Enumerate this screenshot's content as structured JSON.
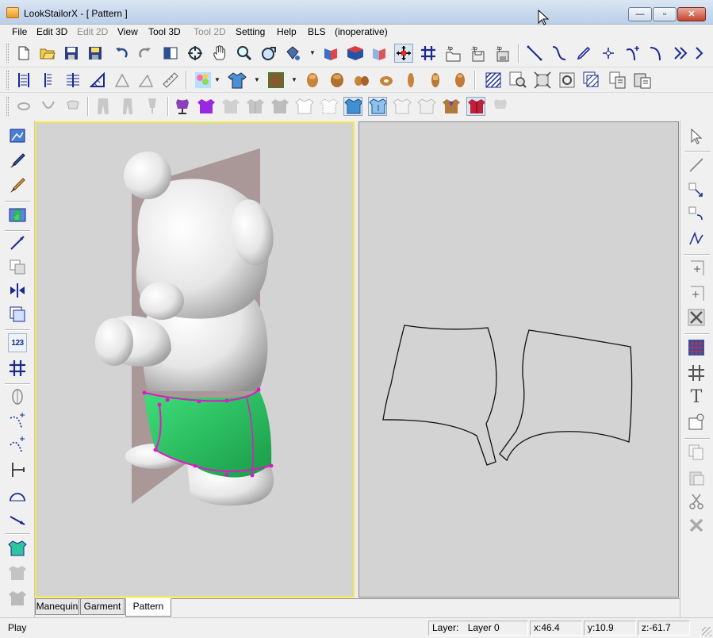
{
  "window": {
    "title": "LookStailorX - [ Pattern ]",
    "buttons": {
      "minimize": "—",
      "maximize": "▫",
      "close": "✕"
    }
  },
  "menu": [
    {
      "label": "File",
      "enabled": true
    },
    {
      "label": "Edit 3D",
      "enabled": true
    },
    {
      "label": "Edit 2D",
      "enabled": false
    },
    {
      "label": "View",
      "enabled": true
    },
    {
      "label": "Tool 3D",
      "enabled": true
    },
    {
      "label": "Tool 2D",
      "enabled": false
    },
    {
      "label": "Setting",
      "enabled": true
    },
    {
      "label": "Help",
      "enabled": true
    },
    {
      "label": "BLS",
      "enabled": true
    },
    {
      "label": "(inoperative)",
      "enabled": true
    }
  ],
  "toolbar1_icons": [
    "new-file-icon",
    "open-folder-icon",
    "save-icon",
    "save-all-icon",
    "undo-icon",
    "redo-icon",
    "split-view-icon",
    "rotate-view-icon",
    "pan-hand-icon",
    "zoom-icon",
    "fit-view-icon",
    "color-fill-icon",
    "measure-icon",
    "book-icon",
    "stack-icon",
    "move-cross-icon",
    "grid-icon",
    "open-tp-icon",
    "save-tp-icon",
    "save-tp-as-icon",
    "line-tool-icon",
    "curve-tool-icon",
    "pen-tool-icon",
    "point-tool-icon",
    "add-curve-icon",
    "bezier-icon",
    "chevron-double-icon",
    "more-icon"
  ],
  "toolbar2_icons": [
    "align-left-icon",
    "align-center-icon",
    "align-right-icon",
    "ruler-angle-icon",
    "triangle-icon",
    "triangle-outline-icon",
    "ruler-icon",
    "texture-icon",
    "shirt-color-icon",
    "grid-color-icon",
    "body-front-icon",
    "body-back-icon",
    "body-torso-icon",
    "body-side-icon",
    "body-slim-icon",
    "body-thin-icon",
    "body-arm-icon",
    "hatch-icon",
    "magnify-page-icon",
    "fit-page-icon",
    "rotate-page-icon",
    "pattern-stack-icon",
    "copy-icon",
    "paste-icon"
  ],
  "toolbar3_icons": [
    "collar-round-icon",
    "collar-v-icon",
    "collar-high-icon",
    "pants-icon",
    "pants-long-icon",
    "dress-form-icon",
    "vest-purple-icon",
    "tshirt-grey-icon",
    "jacket-grey-icon",
    "shirt-grey-icon",
    "shirt-outline-icon",
    "shirt-outline-2-icon",
    "shirt-blue-icon",
    "shirt-blue-sel-icon",
    "shirt-white-icon",
    "shirt-white-2-icon",
    "vest-brown-icon",
    "coat-red-icon",
    "shirt-neck-icon"
  ],
  "left_toolbar_icons": [
    "flag-icon",
    "brush-blue-icon",
    "brush-orange-icon",
    "hand-green-icon",
    "line-draw-icon",
    "blocks-icon",
    "mirror-icon",
    "layers-icon",
    "number-123-icon",
    "grid-hash-icon",
    "split-oval-icon",
    "curve-add-icon",
    "curve-add-2-icon",
    "measure-h-icon",
    "arc-icon",
    "line-diag-icon",
    "shirt-green-icon",
    "shirt-grey-a-icon",
    "shirt-grey-b-icon"
  ],
  "left_toolbar_badge": "123",
  "right_toolbar_icons": [
    "select-arrow-icon",
    "line-icon",
    "transform-a-icon",
    "transform-b-icon",
    "points-icon",
    "frame-a-icon",
    "frame-b-icon",
    "cross-icon",
    "grid-color-icon",
    "grid-hash-icon",
    "text-t-icon",
    "notch-icon",
    "copy-pages-icon",
    "paste-pages-icon",
    "scissors-icon",
    "delete-x-icon"
  ],
  "right_toolbar_text": "T",
  "tabs": [
    {
      "label": "Manequin",
      "active": false
    },
    {
      "label": "Garment",
      "active": false
    },
    {
      "label": "Pattern",
      "active": true
    }
  ],
  "status": {
    "mode": "Play",
    "layer_label": "Layer:",
    "layer_value": "Layer 0",
    "x": "x:46.4",
    "y": "y:10.9",
    "z": "z:-61.7"
  },
  "colors": {
    "viewport_bg": "#d3d3d3",
    "active_frame": "#f4e84a",
    "garment": "#2fd067",
    "seam": "#e317c9",
    "cut_plane": "#9c8486"
  }
}
